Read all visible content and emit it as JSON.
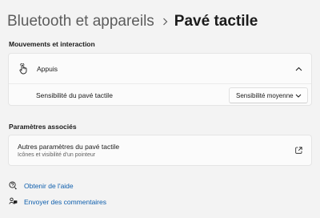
{
  "header": {
    "parent": "Bluetooth et appareils",
    "separator_icon": "chevron-right-icon",
    "current": "Pavé tactile"
  },
  "section1": {
    "title": "Mouvements et interaction",
    "expander": {
      "icon": "tap-gesture-icon",
      "label": "Appuis",
      "expanded": true,
      "chevron_icon": "chevron-up-icon"
    },
    "sensitivity": {
      "label": "Sensibilité du pavé tactile",
      "selected": "Sensibilité moyenne",
      "dropdown_icon": "chevron-down-icon"
    }
  },
  "section2": {
    "title": "Paramètres associés",
    "item": {
      "label": "Autres paramètres du pavé tactile",
      "sublabel": "Icônes et visibilité d'un pointeur",
      "icon": "open-external-icon"
    }
  },
  "footer": {
    "help": {
      "label": "Obtenir de l'aide",
      "icon": "help-icon"
    },
    "feedback": {
      "label": "Envoyer des commentaires",
      "icon": "feedback-icon"
    }
  },
  "colors": {
    "background": "#f3f3f3",
    "card": "#fbfbfb",
    "link": "#0f5fad"
  }
}
